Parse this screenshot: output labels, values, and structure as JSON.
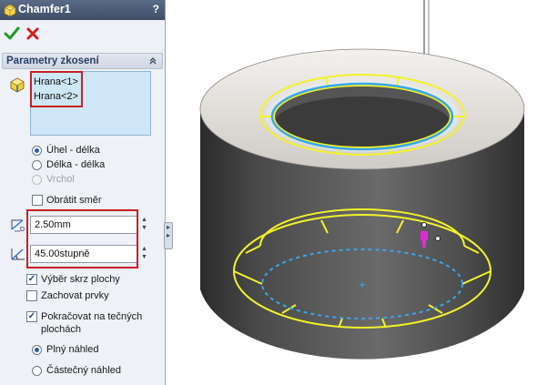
{
  "panel": {
    "title": "Chamfer1",
    "help": "?",
    "group_title": "Parametry zkosení",
    "edges": [
      "Hrana<1>",
      "Hrana<2>"
    ],
    "chamfer_type_options": [
      {
        "label": "Úhel - délka",
        "selected": true,
        "enabled": true
      },
      {
        "label": "Délka - délka",
        "selected": false,
        "enabled": true
      },
      {
        "label": "Vrchol",
        "selected": false,
        "enabled": false
      }
    ],
    "flip_direction": {
      "label": "Obrátit směr",
      "checked": false
    },
    "distance": {
      "value": "2.50mm"
    },
    "angle": {
      "value": "45.00stupně"
    },
    "options": [
      {
        "label": "Výběr skrz plochy",
        "checked": true
      },
      {
        "label": "Zachovat prvky",
        "checked": false
      },
      {
        "label_line1": "Pokračovat na tečných",
        "label_line2": "plochách",
        "checked": true
      }
    ],
    "preview_options": [
      {
        "label": "Plný náhled",
        "selected": true
      },
      {
        "label": "Částečný náhled",
        "selected": false
      }
    ]
  },
  "colors": {
    "selection_yellow": "#f2f22a",
    "preview_cyan": "#3aa6e8",
    "handle_magenta": "#e02ad4",
    "highlight_red": "#c62026"
  },
  "icons": {
    "feature": "chamfer-feature-icon",
    "ok": "checkmark-icon",
    "cancel": "x-icon",
    "collapse": "chevron-up-icon",
    "edges": "edge-selection-icon",
    "distance": "distance-icon",
    "angle": "angle-icon"
  }
}
